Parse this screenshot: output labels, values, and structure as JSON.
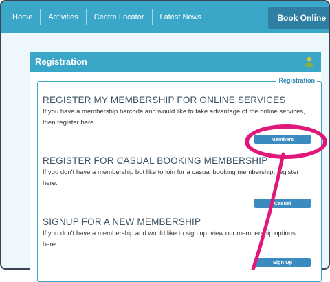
{
  "nav": {
    "items": [
      "Home",
      "Activities",
      "Centre Locator",
      "Latest News"
    ],
    "book_online": "Book Online"
  },
  "registration": {
    "title": "Registration",
    "legend": "Registration",
    "sections": [
      {
        "title": "REGISTER MY MEMBERSHIP FOR ONLINE SERVICES",
        "text": "If you have a membership barcode and would like to take advantage of the online services, then register here.",
        "button": "Members"
      },
      {
        "title": "REGISTER FOR CASUAL BOOKING MEMBERSHIP",
        "text": "If you don't have a membership but like to join for a casual booking membership, register here.",
        "button": "Casual"
      },
      {
        "title": "SIGNUP FOR A NEW MEMBERSHIP",
        "text": "If you don't have a membership and would like to sign up, view our membership options here.",
        "button": "Sign Up"
      }
    ]
  },
  "colors": {
    "nav_bg": "#3aa6c8",
    "book_online_bg": "#2f7fa3",
    "button_bg": "#3a8bbf",
    "annotation": "#e0187a"
  },
  "icons": {
    "header_icon": "user-icon"
  }
}
